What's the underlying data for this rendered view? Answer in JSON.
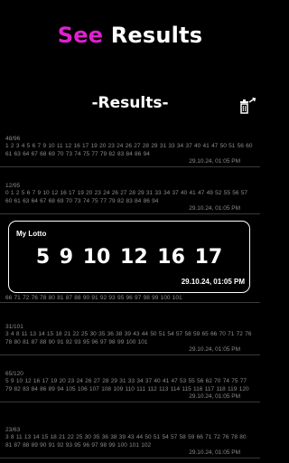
{
  "header": {
    "title_accent": "See",
    "title_rest": "Results",
    "accent_color": "#e020d0"
  },
  "results_heading": "-Results-",
  "icons": {
    "trash": "trash-icon"
  },
  "rows": [
    {
      "count": "48/96",
      "numbers": "1 2 3 4 5 6 7 9 10 11 12 16 17 19 20 23 24 26 27 28 29 31 33 34 37 40 41 47 50 51 56 60 61 63 64 67 68 69 70 73 74 75 77 79 82 83 84 86 94",
      "date": "29.10.24, 01:05 PM"
    },
    {
      "count": "12/95",
      "numbers": "0 1 2 5 6 7 9 10 12 16 17 19 20 23 24 26 27 28 29 31 33 34 37 40 41 47 49 52 55 56 57 60 61 63 64 67 68 69 70 73 74 75 77 79 82 83 84 86 94",
      "date": "29.10.24, 01:05 PM"
    },
    {
      "count": "",
      "numbers": "66 71 72 76 78 80 81 87 88 90 91 92 93 95 96 97 98 99 100 101",
      "date": ""
    },
    {
      "count": "31/101",
      "numbers": "3 4 8 11 13 14 15 18 21 22 25 30 35 36 38 39 43 44 50 51 54 57 58 59 65 66 70 71 72 76 78 80 81 87 88 90 91 92 93 95 96 97 98 99 100 101",
      "date": "29.10.24, 01:05 PM"
    },
    {
      "count": "65/120",
      "numbers": "5 9 10 12 16 17 19 20 23 24 26 27 28 29 31 33 34 37 40 41 47 53 55 56 62 70 74 75 77 79 82 83 84 86 89 94 105 106 107 108 109 110 111 112 113 114 115 116 117 118 119 120",
      "date": "29.10.24, 01:05 PM"
    },
    {
      "count": "23/63",
      "numbers": "3 8 11 13 14 15 18 21 22 25 30 35 36 38 39 43 44 50 51 54 57 58 59 66 71 72 76 78 80 81 87 88 89 90 91 92 93 95 96 97 98 99 100 101 102",
      "date": "29.10.24, 01:05 PM"
    }
  ],
  "card": {
    "name": "My Lotto",
    "numbers": "5 9 10 12 16 17",
    "date": "29.10.24, 01:05 PM"
  }
}
